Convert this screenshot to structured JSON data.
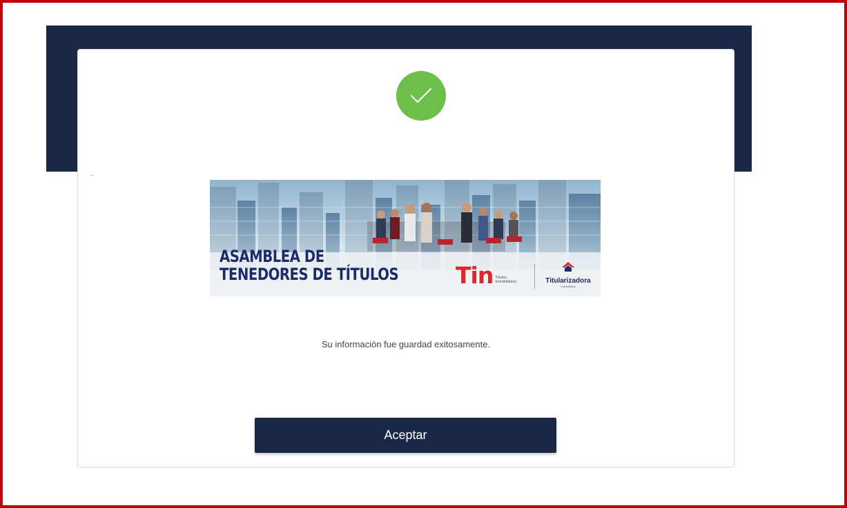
{
  "success_icon": "checkmark-icon",
  "stray_mark": "..",
  "banner": {
    "title_line1": "ASAMBLEA DE",
    "title_line2": "TENEDORES DE TÍTULOS",
    "tin_logo_text": "Tin",
    "tin_logo_subtext": "Títulos Inmobiliarios",
    "titularizadora_logo_text": "Titularizadora",
    "titularizadora_logo_subtext": "Colombiana"
  },
  "message": "Su información fue guardad exitosamente.",
  "accept_button_label": "Aceptar",
  "colors": {
    "header": "#1b2747",
    "success": "#6bbf4a",
    "frame": "#c0000b",
    "banner_title": "#1e2b6b",
    "tin_red": "#e0262a"
  }
}
